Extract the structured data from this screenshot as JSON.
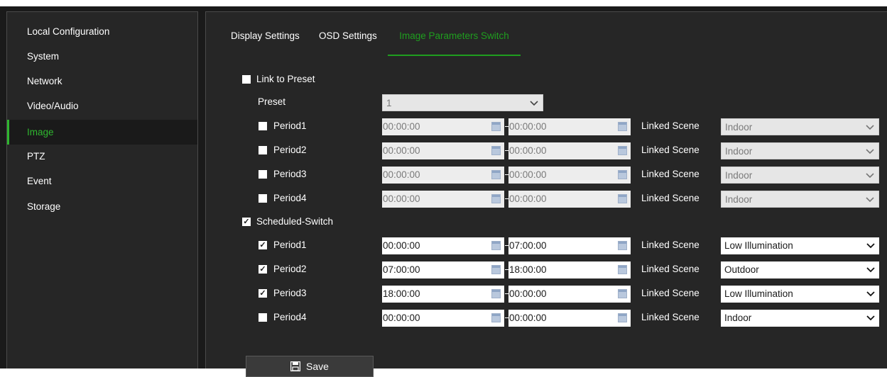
{
  "sidebar": {
    "items": [
      {
        "label": "Local Configuration",
        "active": false
      },
      {
        "label": "System",
        "active": false
      },
      {
        "label": "Network",
        "active": false
      },
      {
        "label": "Video/Audio",
        "active": false
      },
      {
        "label": "Image",
        "active": true
      },
      {
        "label": "PTZ",
        "active": false
      },
      {
        "label": "Event",
        "active": false
      },
      {
        "label": "Storage",
        "active": false
      }
    ]
  },
  "tabs": [
    {
      "label": "Display Settings",
      "active": false
    },
    {
      "label": "OSD Settings",
      "active": false
    },
    {
      "label": "Image Parameters Switch",
      "active": true
    }
  ],
  "link_to_preset": {
    "label": "Link to Preset",
    "checked": false,
    "preset_label": "Preset",
    "preset_value": "1",
    "periods": [
      {
        "label": "Period1",
        "checked": false,
        "start": "00:00:00",
        "end": "00:00:00",
        "scene_label": "Linked Scene",
        "scene": "Indoor"
      },
      {
        "label": "Period2",
        "checked": false,
        "start": "00:00:00",
        "end": "00:00:00",
        "scene_label": "Linked Scene",
        "scene": "Indoor"
      },
      {
        "label": "Period3",
        "checked": false,
        "start": "00:00:00",
        "end": "00:00:00",
        "scene_label": "Linked Scene",
        "scene": "Indoor"
      },
      {
        "label": "Period4",
        "checked": false,
        "start": "00:00:00",
        "end": "00:00:00",
        "scene_label": "Linked Scene",
        "scene": "Indoor"
      }
    ]
  },
  "scheduled_switch": {
    "label": "Scheduled-Switch",
    "checked": true,
    "periods": [
      {
        "label": "Period1",
        "checked": true,
        "start": "00:00:00",
        "end": "07:00:00",
        "scene_label": "Linked Scene",
        "scene": "Low Illumination"
      },
      {
        "label": "Period2",
        "checked": true,
        "start": "07:00:00",
        "end": "18:00:00",
        "scene_label": "Linked Scene",
        "scene": "Outdoor"
      },
      {
        "label": "Period3",
        "checked": true,
        "start": "18:00:00",
        "end": "00:00:00",
        "scene_label": "Linked Scene",
        "scene": "Low Illumination"
      },
      {
        "label": "Period4",
        "checked": false,
        "start": "00:00:00",
        "end": "00:00:00",
        "scene_label": "Linked Scene",
        "scene": "Indoor"
      }
    ]
  },
  "save_button": {
    "label": "Save",
    "icon": "save-icon"
  },
  "colors": {
    "accent": "#1f9e1f",
    "background": "#262626",
    "frame": "#1a1a1a"
  }
}
